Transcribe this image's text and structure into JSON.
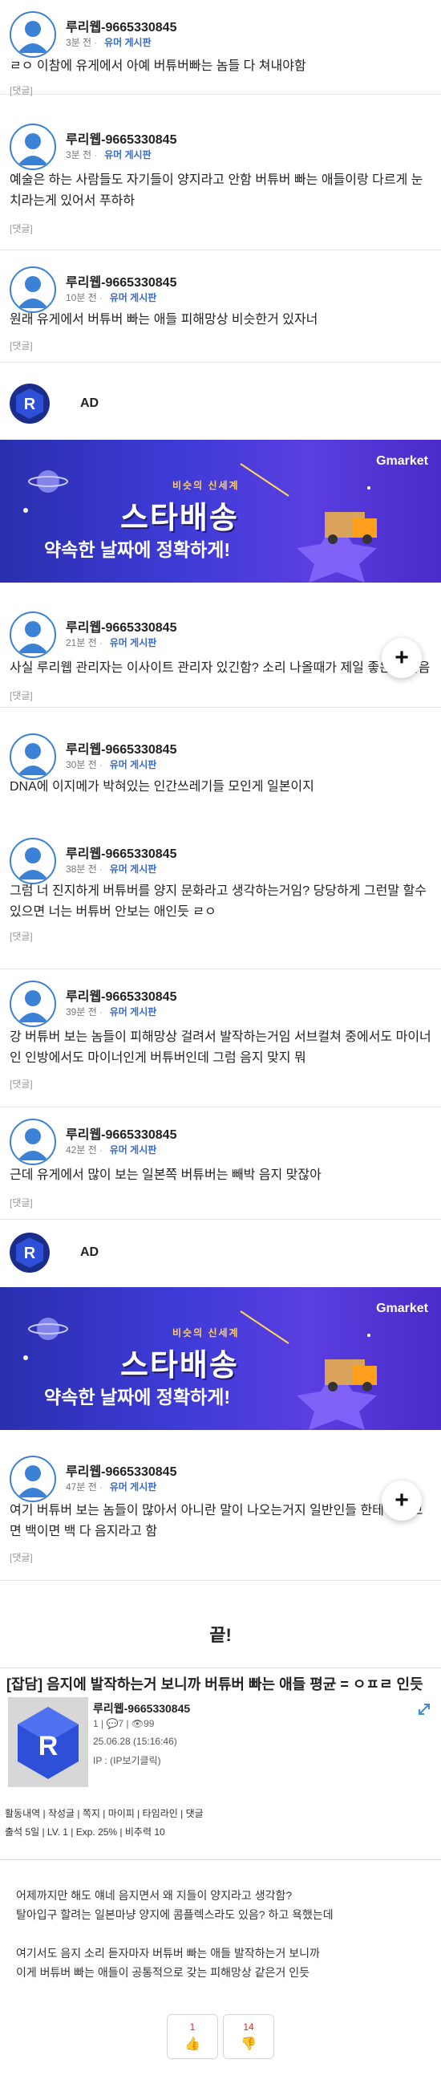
{
  "comments": [
    {
      "author": "루리웹-9665330845",
      "time": "3분 전",
      "board": "유머 게시판",
      "text": "ㄹㅇ 이참에 유게에서 아예 버튜버빠는 놈들 다 쳐내야함",
      "reply": "[댓글]"
    },
    {
      "author": "루리웹-9665330845",
      "time": "3분 전",
      "board": "유머 게시판",
      "text": "예술은 하는 사람들도 자기들이 양지라고 안함 버튜버 빠는 애들이랑 다르게 눈치라는게 있어서 푸하하",
      "reply": "[댓글]"
    },
    {
      "author": "루리웹-9665330845",
      "time": "10분 전",
      "board": "유머 게시판",
      "text": "원래 유게에서 버튜버 빠는 애들 피해망상 비슷한거 있자너",
      "reply": "[댓글]"
    },
    {
      "author": "루리웹-9665330845",
      "time": "21분 전",
      "board": "유머 게시판",
      "text": "사실 루리웹 관리자는 이사이트 관리자 있긴함? 소리 나올때가 제일 좋은거 같음",
      "reply": "[댓글]"
    },
    {
      "author": "루리웹-9665330845",
      "time": "30분 전",
      "board": "유머 게시판",
      "text": "DNA에 이지메가 박혀있는 인간쓰레기들 모인게 일본이지",
      "reply": ""
    },
    {
      "author": "루리웹-9665330845",
      "time": "38분 전",
      "board": "유머 게시판",
      "text": "그럼 너 진지하게 버튜버를 양지 문화라고 생각하는거임? 당당하게 그런말 할수있으면 너는 버튜버 안보는 애인듯 ㄹㅇ",
      "reply": "[댓글]"
    },
    {
      "author": "루리웹-9665330845",
      "time": "39분 전",
      "board": "유머 게시판",
      "text": "강 버튜버 보는 놈들이 피해망상 걸려서 발작하는거임 서브컬쳐 중에서도 마이너인 인방에서도 마이너인게 버튜버인데 그럼 음지 맞지 뭐",
      "reply": "[댓글]"
    },
    {
      "author": "루리웹-9665330845",
      "time": "42분 전",
      "board": "유머 게시판",
      "text": "근데 유게에서 많이 보는 일본쪽 버튜버는 빼박 음지 맞잖아",
      "reply": "[댓글]"
    },
    {
      "author": "루리웹-9665330845",
      "time": "47분 전",
      "board": "유머 게시판",
      "text": "여기 버튜버 보는 놈들이 많아서 아니란 말이 나오는거지 일반인들 한테 물어보면 백이면 백 다 음지라고 함",
      "reply": "[댓글]"
    }
  ],
  "ad": {
    "label": "AD",
    "brand": "Gmarket",
    "small": "비슷의 신세계",
    "title": "스타배송",
    "subtitle": "약속한 날짜에 정확하게!"
  },
  "fab_symbol": "+",
  "end_text": "끝!",
  "post": {
    "title": "[잡담] 음지에 발작하는거 보니까 버튜버 빠는 애들 평균 = ㅇㅍㄹ 인듯",
    "author": "루리웹-9665330845",
    "stats": "1 | 💬7 | 👁99",
    "date": "25.06.28 (15:16:46)",
    "ip": "IP : (IP보기클릭)",
    "links": "활동내역 | 작성글 | 쪽지 | 마이피 | 타임라인 | 댓글",
    "levels": "출석 5일 | LV. 1 | Exp. 25% | 비추력 10",
    "body": [
      "어제까지만 해도 얘네 음지면서 왜 지들이 양지라고 생각함?",
      "탈아입구 할려는 일본마냥 양지에 콤플렉스라도 있음? 하고 욕했는데",
      "",
      "여기서도 음지 소리 듣자마자 버튜버 빠는 애들 발작하는거 보니까",
      "이게 버튜버 빠는 애들이 공통적으로 갖는 피해망상 같은거 인듯"
    ],
    "upvotes": "1",
    "downvotes": "14"
  }
}
